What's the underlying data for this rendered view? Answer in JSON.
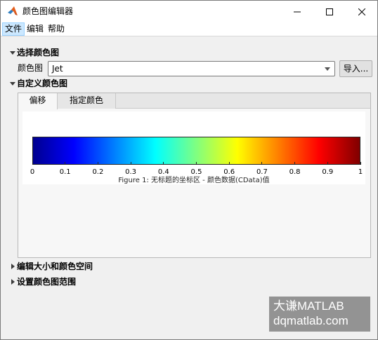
{
  "window": {
    "title": "颜色图编辑器"
  },
  "menubar": {
    "items": [
      "文件",
      "编辑",
      "帮助"
    ]
  },
  "sections": {
    "select_colormap": "选择颜色图",
    "custom_colormap": "自定义颜色图",
    "edit_size": "编辑大小和颜色空间",
    "set_range": "设置颜色图范围"
  },
  "colormap": {
    "label": "颜色图",
    "selected": "Jet",
    "import_label": "导入..."
  },
  "tabs": {
    "offset": "偏移",
    "specify_color": "指定颜色"
  },
  "colorbar": {
    "ticks": [
      "0",
      "0.1",
      "0.2",
      "0.3",
      "0.4",
      "0.5",
      "0.6",
      "0.7",
      "0.8",
      "0.9",
      "1"
    ],
    "caption": "Figure 1: 无标题的坐标区 - 颜色数据(CData)值",
    "colors": [
      "#00008f",
      "#0000ff",
      "#0080ff",
      "#00ffff",
      "#80ff80",
      "#ffff00",
      "#ff8000",
      "#ff0000",
      "#800000"
    ]
  },
  "watermark": {
    "line1": "大谦MATLAB",
    "line2": "dqmatlab.com"
  }
}
